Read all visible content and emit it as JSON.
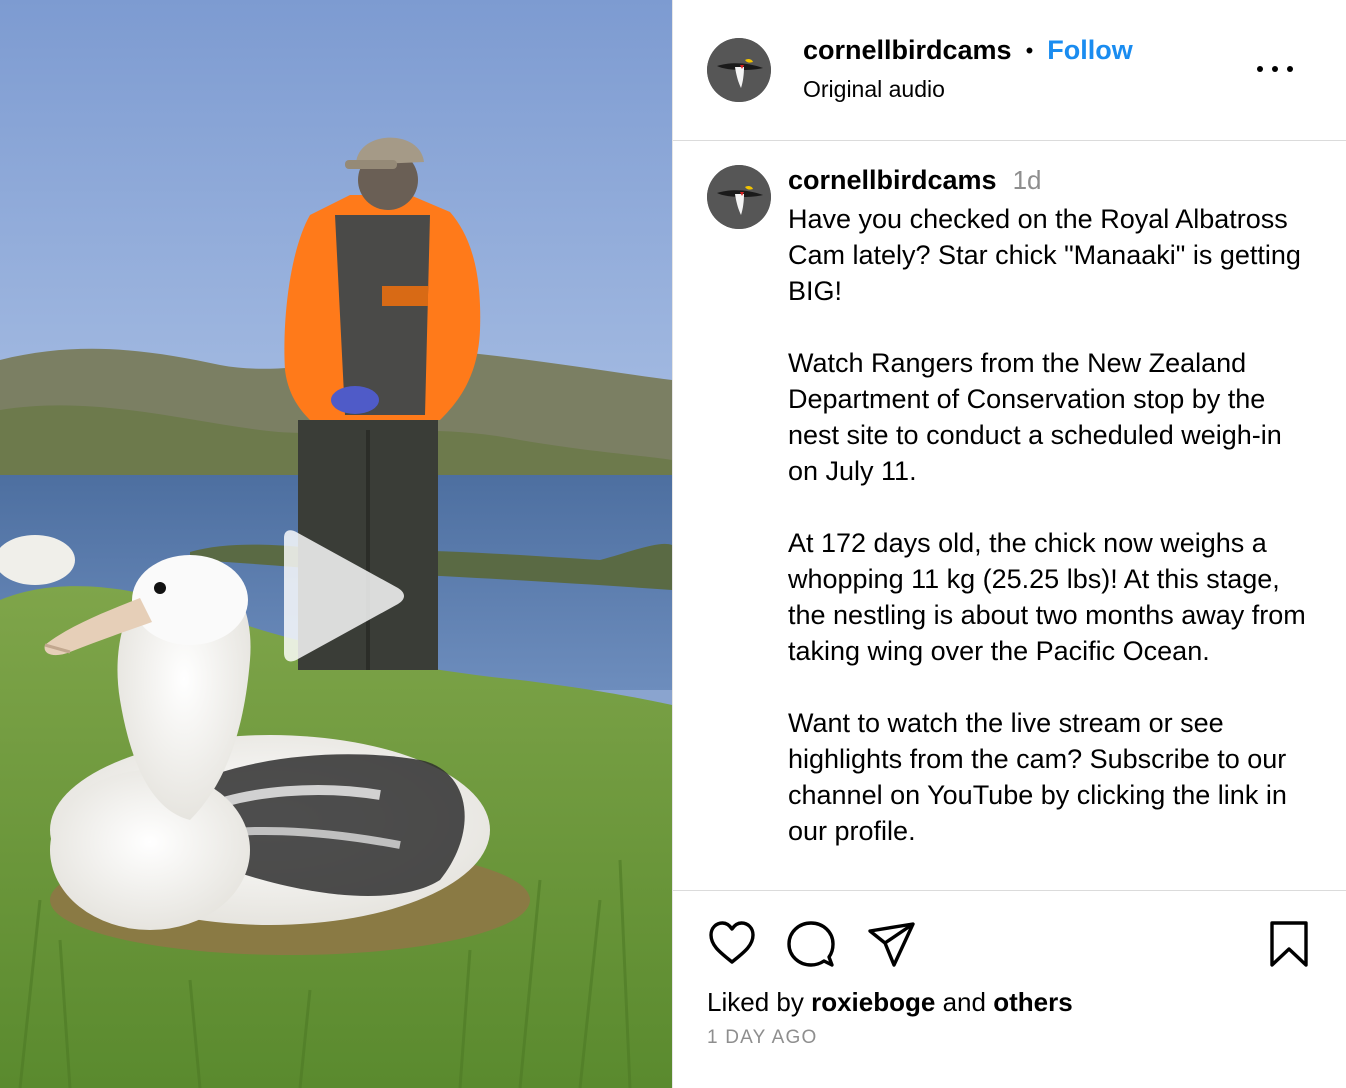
{
  "post": {
    "username": "cornellbirdcams",
    "follow_label": "Follow",
    "separator": "•",
    "audio_label": "Original audio"
  },
  "caption": {
    "username": "cornellbirdcams",
    "age": "1d",
    "paragraphs": [
      "Have you checked on the Royal Albatross Cam lately? Star chick \"Manaaki\" is getting BIG!",
      "Watch Rangers from the New Zealand Department of Conservation stop by the nest site to conduct a scheduled weigh-in on July 11.",
      "At 172 days old, the chick now weighs a whopping 11 kg (25.25 lbs)! At this stage, the nestling is about two months away from taking wing over the Pacific Ocean.",
      "Want to watch the live stream or see highlights from the cam? Subscribe to our channel on YouTube by clicking the link in our profile."
    ]
  },
  "likes": {
    "prefix": "Liked by",
    "user": "roxieboge",
    "middle": "and",
    "others": "others"
  },
  "date_label": "1 DAY AGO",
  "icons": [
    "more-icon",
    "heart-icon",
    "comment-icon",
    "share-icon",
    "bookmark-icon",
    "play-icon"
  ],
  "colors": {
    "follow": "#1a8cf0",
    "muted": "#8e8e8e",
    "divider": "#dbdbdb",
    "jacket": "#ff7a1a"
  }
}
